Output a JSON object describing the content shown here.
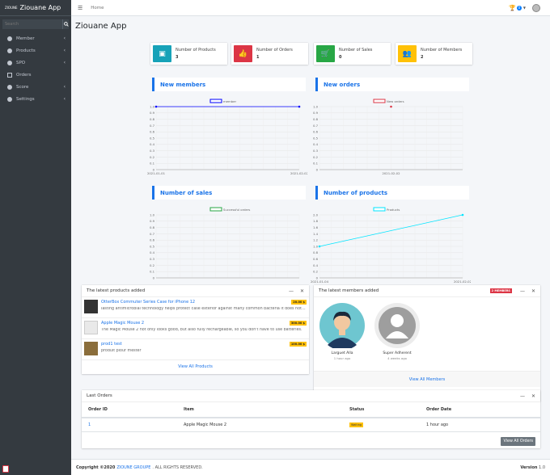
{
  "app": {
    "logo_text": "ZIOUNE",
    "name": "Ziouane App"
  },
  "sidebar": {
    "search_placeholder": "Search",
    "items": [
      {
        "label": "Member",
        "has_children": true
      },
      {
        "label": "Products",
        "has_children": true
      },
      {
        "label": "SPO",
        "has_children": true
      },
      {
        "label": "Orders",
        "has_children": false
      },
      {
        "label": "Score",
        "has_children": true
      },
      {
        "label": "Settings",
        "has_children": true
      }
    ]
  },
  "topbar": {
    "breadcrumb": "Home",
    "notification_count": "0"
  },
  "page": {
    "title": "Ziouane App"
  },
  "stats": [
    {
      "label": "Number of Products",
      "value": "3",
      "color": "#17a2b8",
      "icon": "box-icon"
    },
    {
      "label": "Number of Orders",
      "value": "1",
      "color": "#dc3545",
      "icon": "thumbs-up-icon"
    },
    {
      "label": "Number of Sales",
      "value": "0",
      "color": "#28a745",
      "icon": "cart-icon"
    },
    {
      "label": "Number of Members",
      "value": "2",
      "color": "#ffc107",
      "icon": "users-icon"
    }
  ],
  "chart_titles": {
    "members": "New members",
    "orders": "New orders",
    "sales": "Number of sales",
    "products": "Number of products"
  },
  "chart_data": [
    {
      "type": "line",
      "title": "New members",
      "legend": "member",
      "color": "#0000ff",
      "x": [
        "2021-01-01",
        "2021-02-02"
      ],
      "y": [
        1.0,
        1.0
      ],
      "ylim": [
        0,
        1.0
      ],
      "yticks": [
        "1.0",
        "0.9",
        "0.8",
        "0.7",
        "0.6",
        "0.5",
        "0.4",
        "0.3",
        "0.2",
        "0.1",
        "0"
      ]
    },
    {
      "type": "line",
      "title": "New orders",
      "legend": "New orders",
      "color": "#dc3545",
      "x": [
        "2021-02-02"
      ],
      "y": [
        1.0
      ],
      "ylim": [
        0,
        1.0
      ],
      "yticks": [
        "1.0",
        "0.9",
        "0.8",
        "0.7",
        "0.6",
        "0.5",
        "0.4",
        "0.3",
        "0.2",
        "0.1",
        "0"
      ]
    },
    {
      "type": "line",
      "title": "Number of sales",
      "legend": "Successful orders",
      "color": "#28a745",
      "x": [],
      "y": [],
      "ylim": [
        0,
        1.0
      ],
      "yticks": [
        "1.0",
        "0.9",
        "0.8",
        "0.7",
        "0.6",
        "0.5",
        "0.4",
        "0.3",
        "0.2",
        "0.1",
        "0"
      ]
    },
    {
      "type": "line",
      "title": "Number of products",
      "legend": "Products",
      "color": "#00e5ff",
      "x": [
        "2021-01-04",
        "2021-02-02"
      ],
      "y": [
        1,
        2
      ],
      "ylim": [
        0,
        2.0
      ],
      "yticks": [
        "2.0",
        "1.8",
        "1.6",
        "1.4",
        "1.2",
        "1.0",
        "0.8",
        "0.6",
        "0.4",
        "0.2",
        "0"
      ]
    }
  ],
  "latest_products": {
    "title": "The latest products added",
    "items": [
      {
        "name": "OtterBox Commuter Series Case for iPhone 12",
        "price": "20.00 $",
        "desc": "lasting antimicrobial technology helps protect case exterior against many common bacteria it does not pr..."
      },
      {
        "name": "Apple Magic Mouse 2",
        "price": "300.00 $",
        "desc": "The Magic Mouse 2 not only looks good, but also fully rechargeable, so you don't have to use batteries."
      },
      {
        "name": "prod1 test",
        "price": "100.00 $",
        "desc": "produit plour mester"
      }
    ],
    "footer": "View All Products"
  },
  "latest_members": {
    "title": "The latest members added",
    "badge": "2 MEMBERS",
    "items": [
      {
        "name": "Larguet Alla",
        "ago": "1 hour ago"
      },
      {
        "name": "Super Adherent",
        "ago": "4 weeks ago"
      }
    ],
    "footer": "View All Members"
  },
  "orders": {
    "title": "Last Orders",
    "headers": [
      "Order ID",
      "Item",
      "Status",
      "Order Date"
    ],
    "rows": [
      {
        "id": "1",
        "item": "Apple Magic Mouse 2",
        "status": "Waiting",
        "date": "1 hour ago"
      }
    ],
    "button": "View All Orders"
  },
  "footer": {
    "prefix": "Copyright ©2020",
    "brand": "ZIOUNE GROUPE",
    "suffix": ". ALL RIGHTS RESERVED.",
    "version_label": "Version",
    "version": "1.0"
  }
}
